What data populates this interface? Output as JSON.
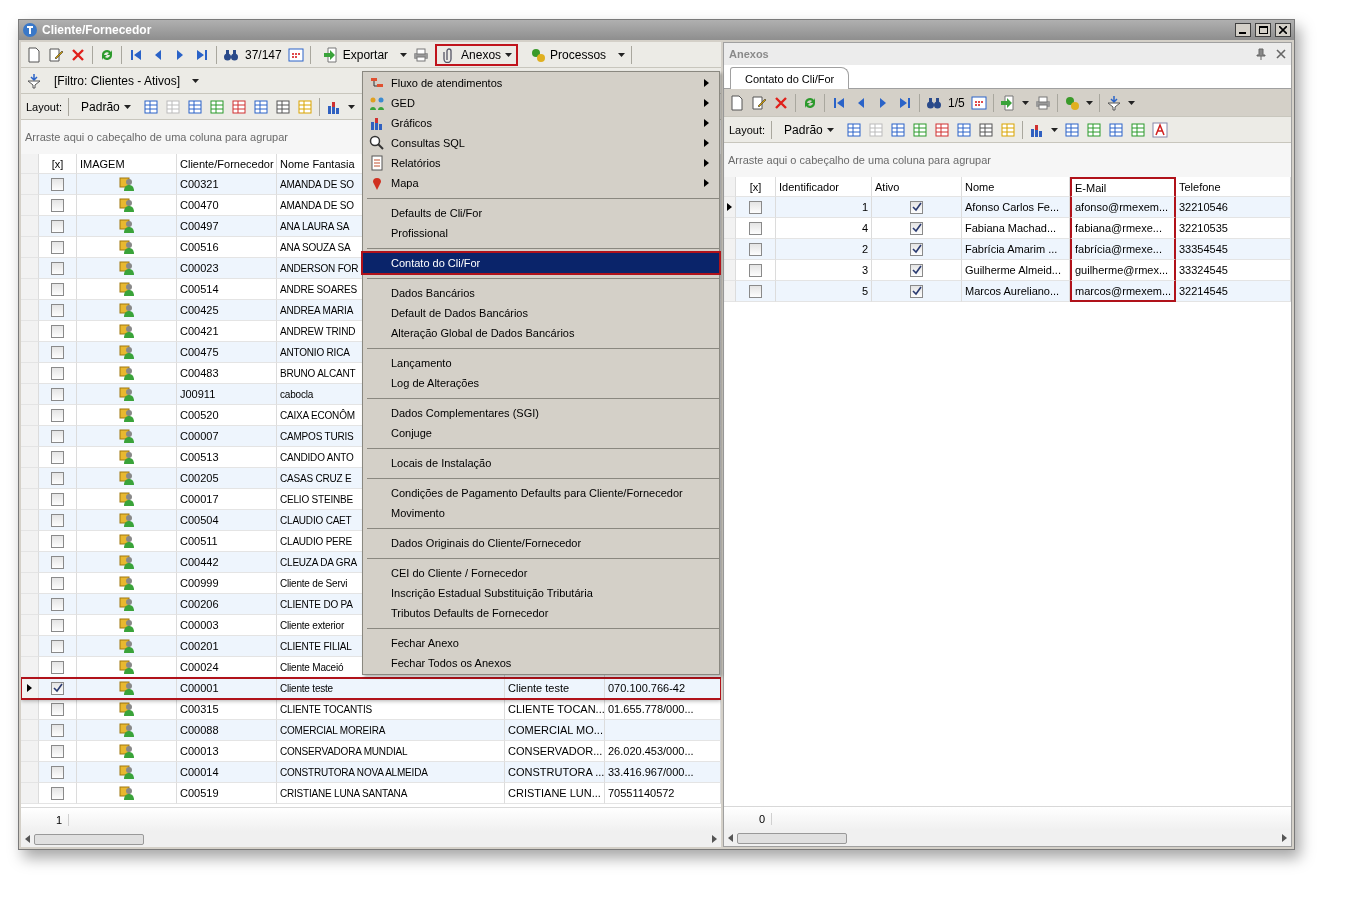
{
  "window": {
    "title": "Cliente/Fornecedor"
  },
  "toolbar": {
    "record_counter": "37/147",
    "export_label": "Exportar",
    "attachments": {
      "label": "Anexos",
      "highlighted": true
    },
    "processes_label": "Processos"
  },
  "filter": {
    "label": "[Filtro: Clientes - Ativos]"
  },
  "layout_bar": {
    "label": "Layout:",
    "preset": "Padrão"
  },
  "group_hint": "Arraste aqui o cabeçalho de uma coluna para agrupar",
  "grid": {
    "columns": [
      "[x]",
      "IMAGEM",
      "Cliente/Fornecedor",
      "Nome Fantasia"
    ],
    "rows": [
      {
        "code": "C00321",
        "name": "AMANDA DE SO",
        "checked": false,
        "current": false,
        "highlighted": false
      },
      {
        "code": "C00470",
        "name": "AMANDA DE SO",
        "checked": false,
        "current": false,
        "highlighted": false
      },
      {
        "code": "C00497",
        "name": "ANA LAURA SA",
        "checked": false,
        "current": false,
        "highlighted": false
      },
      {
        "code": "C00516",
        "name": "ANA SOUZA SA",
        "checked": false,
        "current": false,
        "highlighted": false
      },
      {
        "code": "C00023",
        "name": "ANDERSON FOR",
        "checked": false,
        "current": false,
        "highlighted": false
      },
      {
        "code": "C00514",
        "name": "ANDRE SOARES",
        "checked": false,
        "current": false,
        "highlighted": false
      },
      {
        "code": "C00425",
        "name": "ANDREA MARIA",
        "checked": false,
        "current": false,
        "highlighted": false
      },
      {
        "code": "C00421",
        "name": "ANDREW TRIND",
        "checked": false,
        "current": false,
        "highlighted": false
      },
      {
        "code": "C00475",
        "name": "ANTONIO RICA",
        "checked": false,
        "current": false,
        "highlighted": false
      },
      {
        "code": "C00483",
        "name": "BRUNO ALCANT",
        "checked": false,
        "current": false,
        "highlighted": false
      },
      {
        "code": "J00911",
        "name": "cabocla",
        "checked": false,
        "current": false,
        "highlighted": false
      },
      {
        "code": "C00520",
        "name": "CAIXA ECONÔM",
        "checked": false,
        "current": false,
        "highlighted": false
      },
      {
        "code": "C00007",
        "name": "CAMPOS TURIS",
        "checked": false,
        "current": false,
        "highlighted": false
      },
      {
        "code": "C00513",
        "name": "CANDIDO ANTO",
        "checked": false,
        "current": false,
        "highlighted": false
      },
      {
        "code": "C00205",
        "name": "CASAS CRUZ E",
        "checked": false,
        "current": false,
        "highlighted": false
      },
      {
        "code": "C00017",
        "name": "CELIO STEINBE",
        "checked": false,
        "current": false,
        "highlighted": false
      },
      {
        "code": "C00504",
        "name": "CLAUDIO CAET",
        "checked": false,
        "current": false,
        "highlighted": false
      },
      {
        "code": "C00511",
        "name": "CLAUDIO PERE",
        "checked": false,
        "current": false,
        "highlighted": false
      },
      {
        "code": "C00442",
        "name": "CLEUZA DA GRA",
        "checked": false,
        "current": false,
        "highlighted": false
      },
      {
        "code": "C00999",
        "name": "Cliente de Servi",
        "checked": false,
        "current": false,
        "highlighted": false
      },
      {
        "code": "C00206",
        "name": "CLIENTE DO PA",
        "checked": false,
        "current": false,
        "highlighted": false
      },
      {
        "code": "C00003",
        "name": "Cliente exterior",
        "checked": false,
        "current": false,
        "highlighted": false
      },
      {
        "code": "C00201",
        "name": "CLIENTE FILIAL",
        "checked": false,
        "current": false,
        "highlighted": false
      },
      {
        "code": "C00024",
        "name": "Cliente Maceió",
        "checked": false,
        "current": false,
        "highlighted": false
      },
      {
        "code": "C00001",
        "name": "Cliente teste",
        "column_5": "Cliente teste",
        "column_6": "070.100.766-42",
        "checked": true,
        "current": true,
        "highlighted": true
      },
      {
        "code": "C00315",
        "name": "CLIENTE TOCANTIS",
        "column_5": "CLIENTE TOCAN...",
        "column_6": "01.655.778/000...",
        "checked": false,
        "current": false,
        "highlighted": false
      },
      {
        "code": "C00088",
        "name": "COMERCIAL MOREIRA",
        "column_5": "COMERCIAL MO...",
        "checked": false,
        "current": false,
        "highlighted": false
      },
      {
        "code": "C00013",
        "name": "CONSERVADORA MUNDIAL",
        "column_5": "CONSERVADOR...",
        "column_6": "26.020.453/000...",
        "checked": false,
        "current": false,
        "highlighted": false
      },
      {
        "code": "C00014",
        "name": "CONSTRUTORA NOVA ALMEIDA",
        "column_5": "CONSTRUTORA ...",
        "column_6": "33.416.967/000...",
        "checked": false,
        "current": false,
        "highlighted": false
      },
      {
        "code": "C00519",
        "name": "CRISTIANE LUNA SANTANA",
        "column_5": "CRISTIANE LUN...",
        "column_6": "70551140572",
        "checked": false,
        "current": false,
        "highlighted": false
      }
    ],
    "footer_count": "1"
  },
  "menu": {
    "groups": [
      [
        {
          "label": "Fluxo de atendimentos",
          "submenu": true,
          "selected": false,
          "highlighted": false
        },
        {
          "label": "GED",
          "submenu": true,
          "selected": false,
          "highlighted": false
        },
        {
          "label": "Gráficos",
          "submenu": true,
          "selected": false,
          "highlighted": false
        },
        {
          "label": "Consultas SQL",
          "submenu": true,
          "selected": false,
          "highlighted": false
        },
        {
          "label": "Relatórios",
          "submenu": true,
          "selected": false,
          "highlighted": false
        },
        {
          "label": "Mapa",
          "submenu": true,
          "selected": false,
          "highlighted": false
        }
      ],
      [
        {
          "label": "Defaults de Cli/For",
          "submenu": false,
          "selected": false,
          "highlighted": false
        },
        {
          "label": "Profissional",
          "submenu": false,
          "selected": false,
          "highlighted": false
        }
      ],
      [
        {
          "label": "Contato do Cli/For",
          "submenu": false,
          "selected": true,
          "highlighted": true
        }
      ],
      [
        {
          "label": "Dados Bancários",
          "submenu": false,
          "selected": false,
          "highlighted": false
        },
        {
          "label": "Default de Dados Bancários",
          "submenu": false,
          "selected": false,
          "highlighted": false
        },
        {
          "label": "Alteração Global de Dados Bancários",
          "submenu": false,
          "selected": false,
          "highlighted": false
        }
      ],
      [
        {
          "label": "Lançamento",
          "submenu": false,
          "selected": false,
          "highlighted": false
        },
        {
          "label": "Log de Alterações",
          "submenu": false,
          "selected": false,
          "highlighted": false
        }
      ],
      [
        {
          "label": "Dados Complementares (SGI)",
          "submenu": false,
          "selected": false,
          "highlighted": false
        },
        {
          "label": "Conjuge",
          "submenu": false,
          "selected": false,
          "highlighted": false
        }
      ],
      [
        {
          "label": "Locais de Instalação",
          "submenu": false,
          "selected": false,
          "highlighted": false
        }
      ],
      [
        {
          "label": "Condições de Pagamento Defaults para Cliente/Fornecedor",
          "submenu": false,
          "selected": false,
          "highlighted": false
        },
        {
          "label": "Movimento",
          "submenu": false,
          "selected": false,
          "highlighted": false
        }
      ],
      [
        {
          "label": "Dados Originais do Cliente/Fornecedor",
          "submenu": false,
          "selected": false,
          "highlighted": false
        }
      ],
      [
        {
          "label": "CEI do Cliente /  Fornecedor",
          "submenu": false,
          "selected": false,
          "highlighted": false
        },
        {
          "label": "Inscrição Estadual Substituição Tributária",
          "submenu": false,
          "selected": false,
          "highlighted": false
        },
        {
          "label": "Tributos Defaults de Fornecedor",
          "submenu": false,
          "selected": false,
          "highlighted": false
        }
      ],
      [
        {
          "label": "Fechar Anexo",
          "submenu": false,
          "selected": false,
          "highlighted": false
        },
        {
          "label": "Fechar Todos os Anexos",
          "submenu": false,
          "selected": false,
          "highlighted": false
        }
      ]
    ]
  },
  "attachments_panel": {
    "title": "Anexos",
    "tabs": [
      {
        "label": "Contato do Cli/For",
        "selected": true
      }
    ],
    "toolbar": {
      "record_counter": "1/5"
    },
    "layout_bar": {
      "label": "Layout:",
      "preset": "Padrão"
    },
    "group_hint": "Arraste aqui o cabeçalho de uma coluna para agrupar",
    "columns": [
      {
        "label": "[x]",
        "highlighted": false
      },
      {
        "label": "Identificador",
        "highlighted": false
      },
      {
        "label": "Ativo",
        "highlighted": false
      },
      {
        "label": "Nome",
        "highlighted": false
      },
      {
        "label": "E-Mail",
        "highlighted": true
      },
      {
        "label": "Telefone",
        "highlighted": false
      }
    ],
    "rows": [
      {
        "id": "1",
        "name": "Afonso Carlos Fe...",
        "email": "afonso@rmexem...",
        "phone": "32210546",
        "checked": false,
        "active": true,
        "current": true
      },
      {
        "id": "4",
        "name": "Fabiana Machad...",
        "email": "fabiana@rmexe...",
        "phone": "32210535",
        "checked": false,
        "active": true,
        "current": false
      },
      {
        "id": "2",
        "name": "Fabrícia Amarim ...",
        "email": "fabrícia@rmexe...",
        "phone": "33354545",
        "checked": false,
        "active": true,
        "current": false
      },
      {
        "id": "3",
        "name": "Guilherme Almeid...",
        "email": "guilherme@rmex...",
        "phone": "33324545",
        "checked": false,
        "active": true,
        "current": false
      },
      {
        "id": "5",
        "name": "Marcos Aureliano...",
        "email": "marcos@rmexem...",
        "phone": "32214545",
        "checked": false,
        "active": true,
        "current": false
      }
    ],
    "footer_count": "0"
  }
}
